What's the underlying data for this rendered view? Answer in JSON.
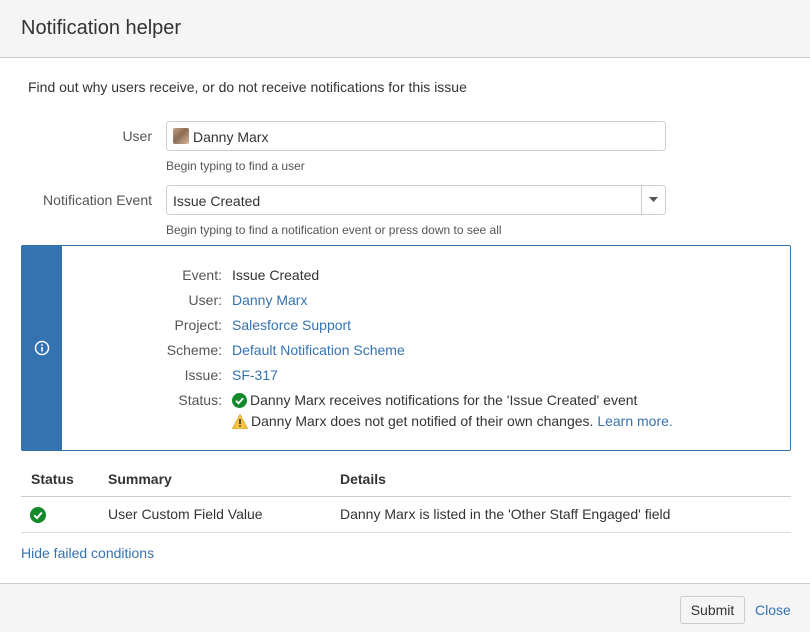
{
  "dialog": {
    "title": "Notification helper"
  },
  "intro": "Find out why users receive, or do not receive notifications for this issue",
  "form": {
    "user_label": "User",
    "user_value": "Danny Marx",
    "user_help": "Begin typing to find a user",
    "event_label": "Notification Event",
    "event_value": "Issue Created",
    "event_help": "Begin typing to find a notification event or press down to see all"
  },
  "info": {
    "icon": "info-icon",
    "rows": [
      {
        "key": "Event:",
        "value": "Issue Created"
      },
      {
        "key": "User:",
        "value": "Danny Marx"
      },
      {
        "key": "Project:",
        "value": "Salesforce Support"
      },
      {
        "key": "Scheme:",
        "value": "Default Notification Scheme"
      },
      {
        "key": "Issue:",
        "value": "SF-317"
      },
      {
        "key": "Status:",
        "value": "Danny Marx receives notifications for the 'Issue Created' event"
      }
    ],
    "warning_text": "Danny Marx does not get notified of their own changes.",
    "learn_more": "Learn more",
    "period": ".",
    "colors": {
      "accent": "#3572b0",
      "success": "#14892c",
      "warning": "#f6c342"
    }
  },
  "table": {
    "headers": [
      "Status",
      "Summary",
      "Details"
    ],
    "rows": [
      {
        "status_icon": "check-circle-icon",
        "summary": "User Custom Field Value",
        "details": "Danny Marx is listed in the 'Other Staff Engaged' field"
      }
    ]
  },
  "hide_failed": "Hide failed conditions",
  "footer": {
    "submit": "Submit",
    "close": "Close"
  }
}
